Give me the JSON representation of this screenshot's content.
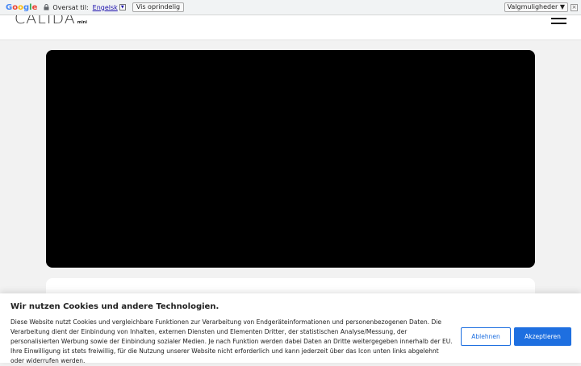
{
  "translate_bar": {
    "logo_letters": [
      "G",
      "o",
      "o",
      "g",
      "l",
      "e"
    ],
    "translated_to_label": "Oversat til:",
    "language": "Engelsk",
    "show_original_label": "Vis oprindelig",
    "options_label": "Valgmuligheder ▼",
    "close_symbol": "×"
  },
  "site": {
    "logo_text": "CALIDA",
    "logo_sub": "mini"
  },
  "cookie": {
    "title": "Wir nutzen Cookies und andere Technologien.",
    "text": "Diese Website nutzt Cookies und vergleichbare Funktionen zur Verarbeitung von Endgeräteinformationen und personenbezogenen Daten. Die Verarbeitung dient der Einbindung von Inhalten, externen Diensten und Elementen Dritter, der statistischen Analyse/Messung, der personalisierten Werbung sowie der Einbindung sozialer Medien. Je nach Funktion werden dabei Daten an Dritte weitergegeben innerhalb der EU. Ihre Einwilligung ist stets freiwillig, für die Nutzung unserer Website nicht erforderlich und kann jederzeit über das Icon unten links abgelehnt oder widerrufen werden.",
    "reject_label": "Ablehnen",
    "accept_label": "Akzeptieren"
  },
  "colors": {
    "accent": "#1e6fe0",
    "video_bg": "#000000",
    "page_bg": "#f2f2f2"
  }
}
